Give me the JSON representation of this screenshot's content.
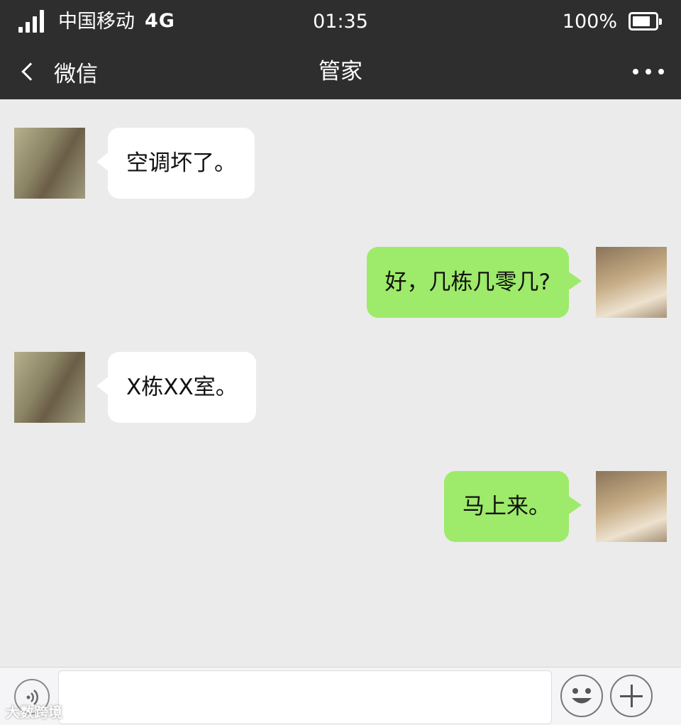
{
  "status_bar": {
    "carrier": "中国移动",
    "network": "4G",
    "time": "01:35",
    "battery_percent": "100%",
    "battery_level": 0.8,
    "signal_icon": "signal-bars-icon",
    "battery_icon": "battery-icon"
  },
  "nav": {
    "back_label": "微信",
    "back_icon": "chevron-left-icon",
    "title": "管家",
    "more_icon": "more-dots-icon"
  },
  "messages": [
    {
      "side": "left",
      "avatar": "girl-avatar",
      "text": "空调坏了。"
    },
    {
      "side": "right",
      "avatar": "boy-avatar",
      "text": "好，几栋几零几?"
    },
    {
      "side": "left",
      "avatar": "girl-avatar",
      "text": "X栋XX室。"
    },
    {
      "side": "right",
      "avatar": "boy-avatar",
      "text": "马上来。"
    }
  ],
  "input_bar": {
    "voice_icon": "voice-icon",
    "input_value": "",
    "emoji_icon": "emoji-icon",
    "plus_icon": "plus-icon"
  },
  "colors": {
    "header_bg": "#2e2e2e",
    "chat_bg": "#ebebeb",
    "incoming_bubble": "#ffffff",
    "outgoing_bubble": "#9eea6a"
  },
  "watermark": "大数跨境"
}
